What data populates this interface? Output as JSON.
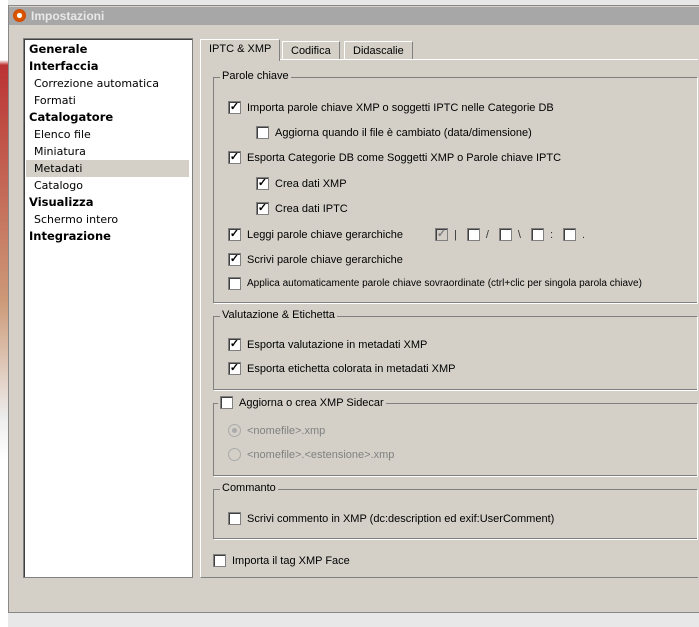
{
  "window": {
    "title": "Impostazioni"
  },
  "sidebar": {
    "items": [
      {
        "label": "Generale",
        "level": 0
      },
      {
        "label": "Interfaccia",
        "level": 0
      },
      {
        "label": "Correzione automatica",
        "level": 1
      },
      {
        "label": "Formati",
        "level": 1
      },
      {
        "label": "Catalogatore",
        "level": 0
      },
      {
        "label": "Elenco file",
        "level": 1
      },
      {
        "label": "Miniatura",
        "level": 1
      },
      {
        "label": "Metadati",
        "level": 1,
        "selected": true
      },
      {
        "label": "Catalogo",
        "level": 1
      },
      {
        "label": "Visualizza",
        "level": 0
      },
      {
        "label": "Schermo intero",
        "level": 1
      },
      {
        "label": "Integrazione",
        "level": 0
      }
    ]
  },
  "tabs": [
    "IPTC & XMP",
    "Codifica",
    "Didascalie"
  ],
  "keywords": {
    "title": "Parole chiave",
    "import": "Importa parole chiave XMP o soggetti IPTC nelle Categorie DB",
    "update": "Aggiorna quando il file è cambiato (data/dimensione)",
    "export": "Esporta Categorie DB come Soggetti XMP o Parole chiave IPTC",
    "xmp": "Crea dati XMP",
    "iptc": "Crea dati IPTC",
    "read_hier": "Leggi parole chiave gerarchiche",
    "separators": [
      "|",
      "/",
      "\\",
      ":",
      "."
    ],
    "write_hier": "Scrivi parole chiave gerarchiche",
    "auto_apply": "Applica automaticamente parole chiave sovraordinate (ctrl+clic per singola parola chiave)"
  },
  "rating": {
    "title": "Valutazione & Etichetta",
    "export_rating": "Esporta valutazione in metadati XMP",
    "export_label": "Esporta etichetta colorata in metadati XMP"
  },
  "sidecar": {
    "title": "Aggiorna o crea XMP Sidecar",
    "opt1": "<nomefile>.xmp",
    "opt2": "<nomefile>.<estensione>.xmp"
  },
  "comment": {
    "title": "Commanto",
    "write": "Scrivi commento in XMP (dc:description ed exif:UserComment)"
  },
  "face": "Importa il tag XMP Face"
}
